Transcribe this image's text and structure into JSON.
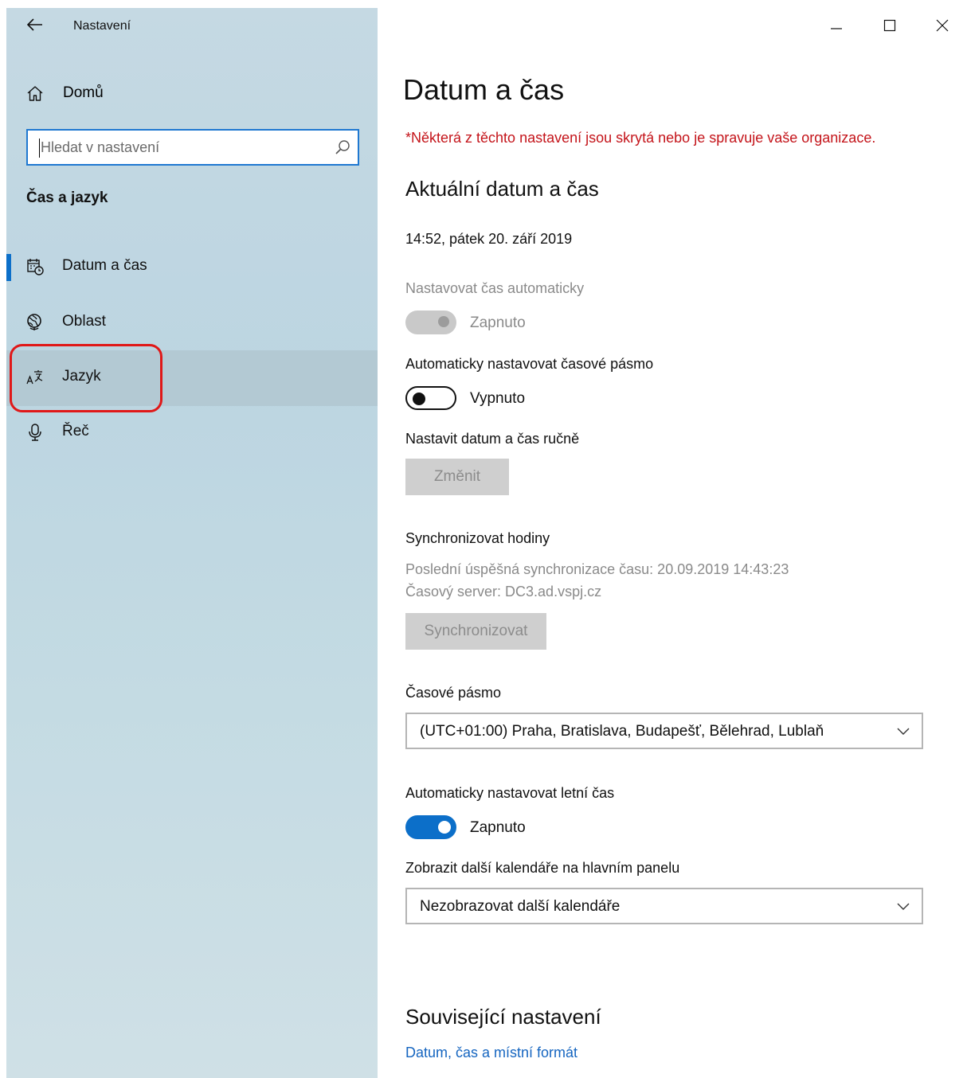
{
  "window": {
    "app_title": "Nastavení",
    "controls": {
      "minimize": "minimize",
      "maximize": "maximize",
      "close": "close"
    }
  },
  "sidebar": {
    "home_label": "Domů",
    "search_placeholder": "Hledat v nastavení",
    "section_title": "Čas a jazyk",
    "items": [
      {
        "label": "Datum a čas",
        "icon": "calendar-clock-icon",
        "selected": true
      },
      {
        "label": "Oblast",
        "icon": "globe-icon",
        "selected": false
      },
      {
        "label": "Jazyk",
        "icon": "language-icon",
        "selected": false,
        "hover": true
      },
      {
        "label": "Řeč",
        "icon": "microphone-icon",
        "selected": false
      }
    ]
  },
  "main": {
    "title": "Datum a čas",
    "warning": "*Některá z těchto nastavení jsou skrytá nebo je spravuje vaše organizace.",
    "current_heading": "Aktuální datum a čas",
    "current_value": "14:52, pátek 20. září 2019",
    "auto_time": {
      "label": "Nastavovat čas automaticky",
      "state": "Zapnuto",
      "on": true,
      "disabled": true
    },
    "auto_timezone": {
      "label": "Automaticky nastavovat časové pásmo",
      "state": "Vypnuto",
      "on": false,
      "disabled": false
    },
    "manual": {
      "label": "Nastavit datum a čas ručně",
      "button": "Změnit"
    },
    "sync": {
      "label": "Synchronizovat hodiny",
      "last_sync": "Poslední úspěšná synchronizace času: 20.09.2019 14:43:23",
      "server": "Časový server: DC3.ad.vspj.cz",
      "button": "Synchronizovat"
    },
    "timezone": {
      "label": "Časové pásmo",
      "value": "(UTC+01:00) Praha, Bratislava, Budapešť, Bělehrad, Lublaň"
    },
    "dst": {
      "label": "Automaticky nastavovat letní čas",
      "state": "Zapnuto",
      "on": true
    },
    "calendars": {
      "label": "Zobrazit další kalendáře na hlavním panelu",
      "value": "Nezobrazovat další kalendáře"
    },
    "related_heading": "Související nastavení",
    "related_link": "Datum, čas a místní formát"
  },
  "colors": {
    "accent": "#0c6fc9",
    "warning": "#c4141a",
    "annotation": "#e01818",
    "sidebar_bg": "#c5d9e3"
  }
}
